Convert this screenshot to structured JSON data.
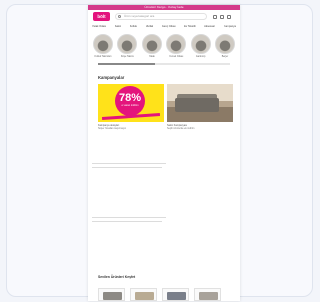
{
  "topbar": {
    "text": "Ücretsiz Kargo · Kolay İade"
  },
  "header": {
    "logo": "bölt",
    "search_placeholder": "Ürün veya kategori ara"
  },
  "nav": {
    "items": [
      "Yatak Odası",
      "Salon",
      "Koltuk",
      "Mutfak",
      "Genç Odası",
      "Ev Tekstili",
      "Aksesuar",
      "Kampanya"
    ]
  },
  "categories": [
    {
      "label": "Koltuk Takımları"
    },
    {
      "label": "Köşe Takımı"
    },
    {
      "label": "Yatak"
    },
    {
      "label": "Yemek Odası"
    },
    {
      "label": "Gardırop"
    },
    {
      "label": "Berjer"
    }
  ],
  "scroll_progress": 0.43,
  "section": {
    "title": "Kampanyalar"
  },
  "promos": [
    {
      "badge_value": "78%",
      "badge_sub": "e varan indirim",
      "caption": "Kampanya detayları",
      "caption2": "Süper fırsatları kaçırmayın"
    },
    {
      "caption": "Salon Kampanyası",
      "caption2": "Seçili ürünlerde ek indirim"
    }
  ],
  "bottom": {
    "title": "Sevilen Ürünleri Keşfet"
  },
  "colors": {
    "brand": "#e3137d",
    "topbar": "#d43a8a",
    "promo_yellow": "#ffe21a"
  }
}
